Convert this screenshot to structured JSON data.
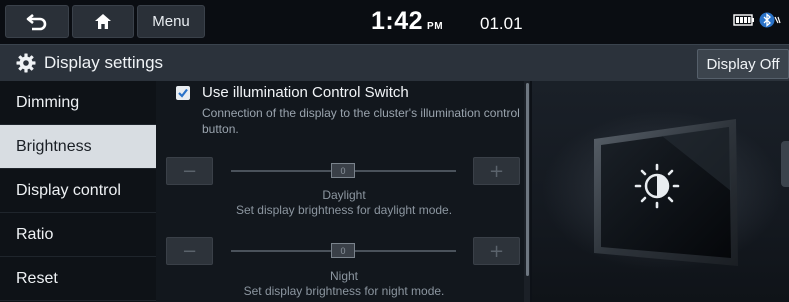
{
  "topbar": {
    "menu_label": "Menu",
    "time": "1:42",
    "ampm": "PM",
    "date": "01.01",
    "icons": [
      "back-icon",
      "home-icon",
      "battery-icon",
      "bluetooth-icon"
    ]
  },
  "titlebar": {
    "title": "Display settings",
    "display_off_label": "Display Off"
  },
  "sidebar": {
    "items": [
      {
        "label": "Dimming"
      },
      {
        "label": "Brightness"
      },
      {
        "label": "Display control"
      },
      {
        "label": "Ratio"
      },
      {
        "label": "Reset"
      }
    ],
    "active_index": 1
  },
  "content": {
    "illumination": {
      "checked": true,
      "label": "Use illumination Control Switch",
      "description": "Connection of the display to the cluster's illumination control button."
    },
    "daylight": {
      "value": "0",
      "title": "Daylight",
      "description": "Set display brightness for daylight mode."
    },
    "night": {
      "value": "0",
      "title": "Night",
      "description": "Set display brightness for night mode."
    }
  },
  "colors": {
    "background": "#0d1117",
    "active_item_bg": "#d8dde2",
    "checkbox_check": "#2a72c8"
  }
}
